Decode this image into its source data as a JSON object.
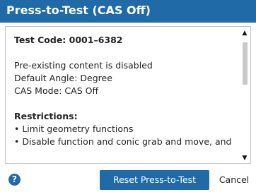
{
  "dialog": {
    "title": "Press-to-Test (CAS Off)",
    "test_code": "Test Code: 0001–6382",
    "lines": [
      "Pre-existing content is disabled",
      "Default Angle: Degree",
      "CAS Mode: CAS Off"
    ],
    "restrictions_heading": "Restrictions:",
    "restrictions": [
      "• Limit geometry functions",
      "• Disable function and conic grab and move, and"
    ],
    "help_icon_glyph": "?",
    "primary_button_label": "Reset Press-to-Test",
    "cancel_button_label": "Cancel",
    "colors": {
      "accent": "#1f6aa7"
    }
  }
}
